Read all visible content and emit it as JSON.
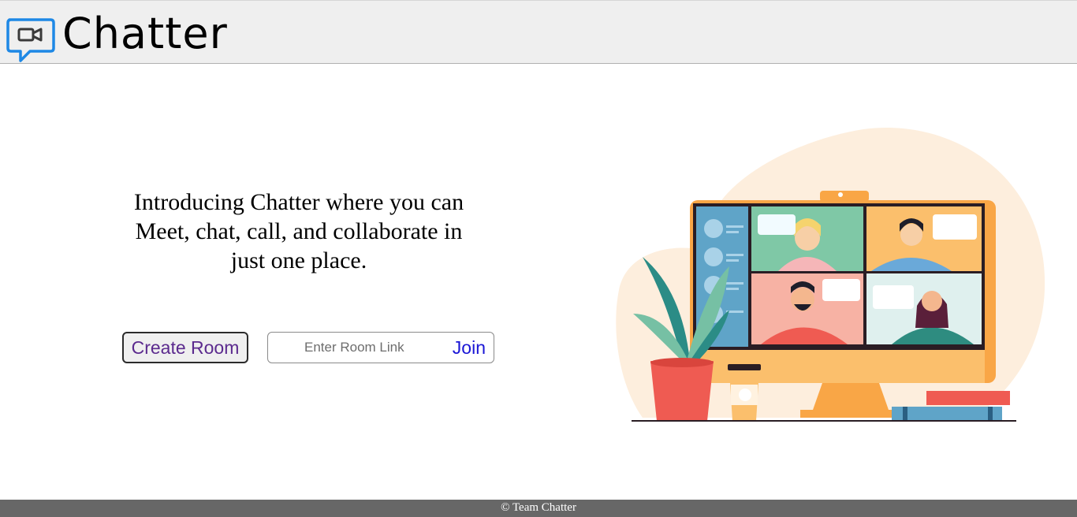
{
  "header": {
    "brand": "Chatter",
    "logo_icon": "video-chat-bubble-icon"
  },
  "hero": {
    "text": "Introducing Chatter where you can Meet, chat, call, and collaborate in just one place."
  },
  "actions": {
    "create_room_label": "Create Room",
    "room_link_placeholder": "Enter Room Link",
    "room_link_value": "",
    "join_label": "Join"
  },
  "illustration": {
    "description_icon": "video-conference-illustration"
  },
  "footer": {
    "text": "© Team Chatter"
  },
  "colors": {
    "accent_blue": "#1e88e5",
    "join_blue": "#1a16d6",
    "create_purple": "#5b2a8e",
    "footer_bg": "#676767"
  }
}
